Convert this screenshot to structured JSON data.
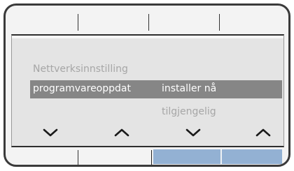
{
  "menu": {
    "item_network": "Nettverksinnstilling",
    "item_selected": "programvareoppdat",
    "selected_value": "installer nå",
    "sub_value": "tilgjengelig"
  },
  "softkeys": {
    "arrows": [
      {
        "icon": "chevron-down-icon"
      },
      {
        "icon": "chevron-up-icon"
      },
      {
        "icon": "chevron-down-icon"
      },
      {
        "icon": "chevron-up-icon"
      }
    ],
    "highlight_color": "#93b1d3"
  },
  "colors": {
    "selection": "#868686",
    "screen": "#e4e4e4",
    "dim_text": "#a6a6a6"
  }
}
